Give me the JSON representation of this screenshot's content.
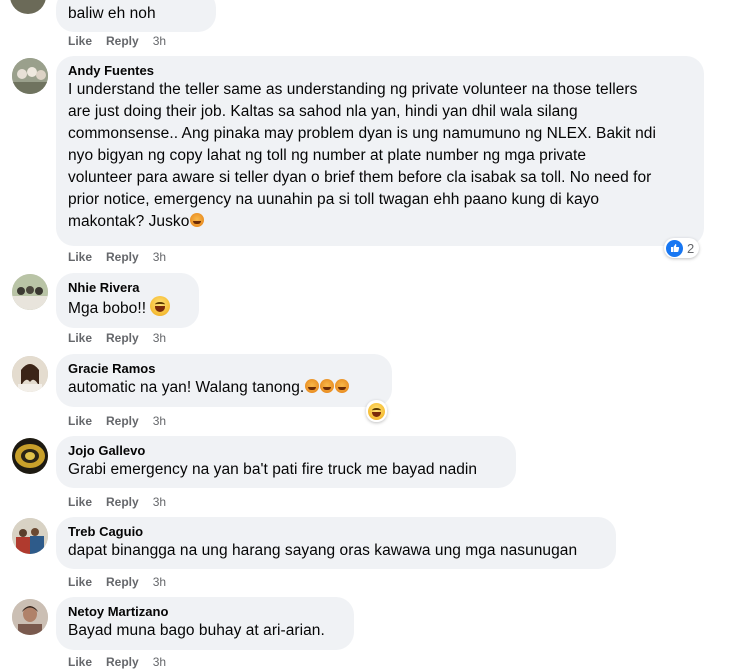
{
  "actions": {
    "like": "Like",
    "reply": "Reply"
  },
  "comments": [
    {
      "name": "",
      "text": "baliw eh noh",
      "time": "3h"
    },
    {
      "name": "Andy Fuentes",
      "lines": [
        "I understand the teller same as understanding ng private volunteer na those tellers",
        "are just doing their job. Kaltas sa sahod nla yan, hindi yan dhil wala silang",
        "commonsense.. Ang pinaka may problem dyan is ung namumuno ng NLEX. Bakit ndi",
        "nyo bigyan ng copy lahat ng toll ng number at plate number ng mga private",
        "volunteer para aware si teller dyan o brief them before cla isabak sa toll. No need for",
        "prior notice, emergency na uunahin pa si toll twagan ehh paano kung di kayo",
        "makontak? Jusko"
      ],
      "time": "3h",
      "reaction_count": "2"
    },
    {
      "name": "Nhie Rivera",
      "text": "Mga bobo!!",
      "time": "3h"
    },
    {
      "name": "Gracie Ramos",
      "text": "automatic na yan! Walang tanong.",
      "time": "3h"
    },
    {
      "name": "Jojo Gallevo",
      "text": "Grabi emergency na yan ba't pati fire truck me bayad nadin",
      "time": "3h"
    },
    {
      "name": "Treb Caguio",
      "text": "dapat binangga na ung harang sayang oras kawawa ung mga nasunugan",
      "time": "3h"
    },
    {
      "name": "Netoy Martizano",
      "text": "Bayad muna bago buhay at ari-arian.",
      "time": "3h"
    }
  ],
  "colors": {
    "bubble": "#f0f2f5",
    "meta": "#65676b",
    "like_blue": "#1877f2"
  }
}
